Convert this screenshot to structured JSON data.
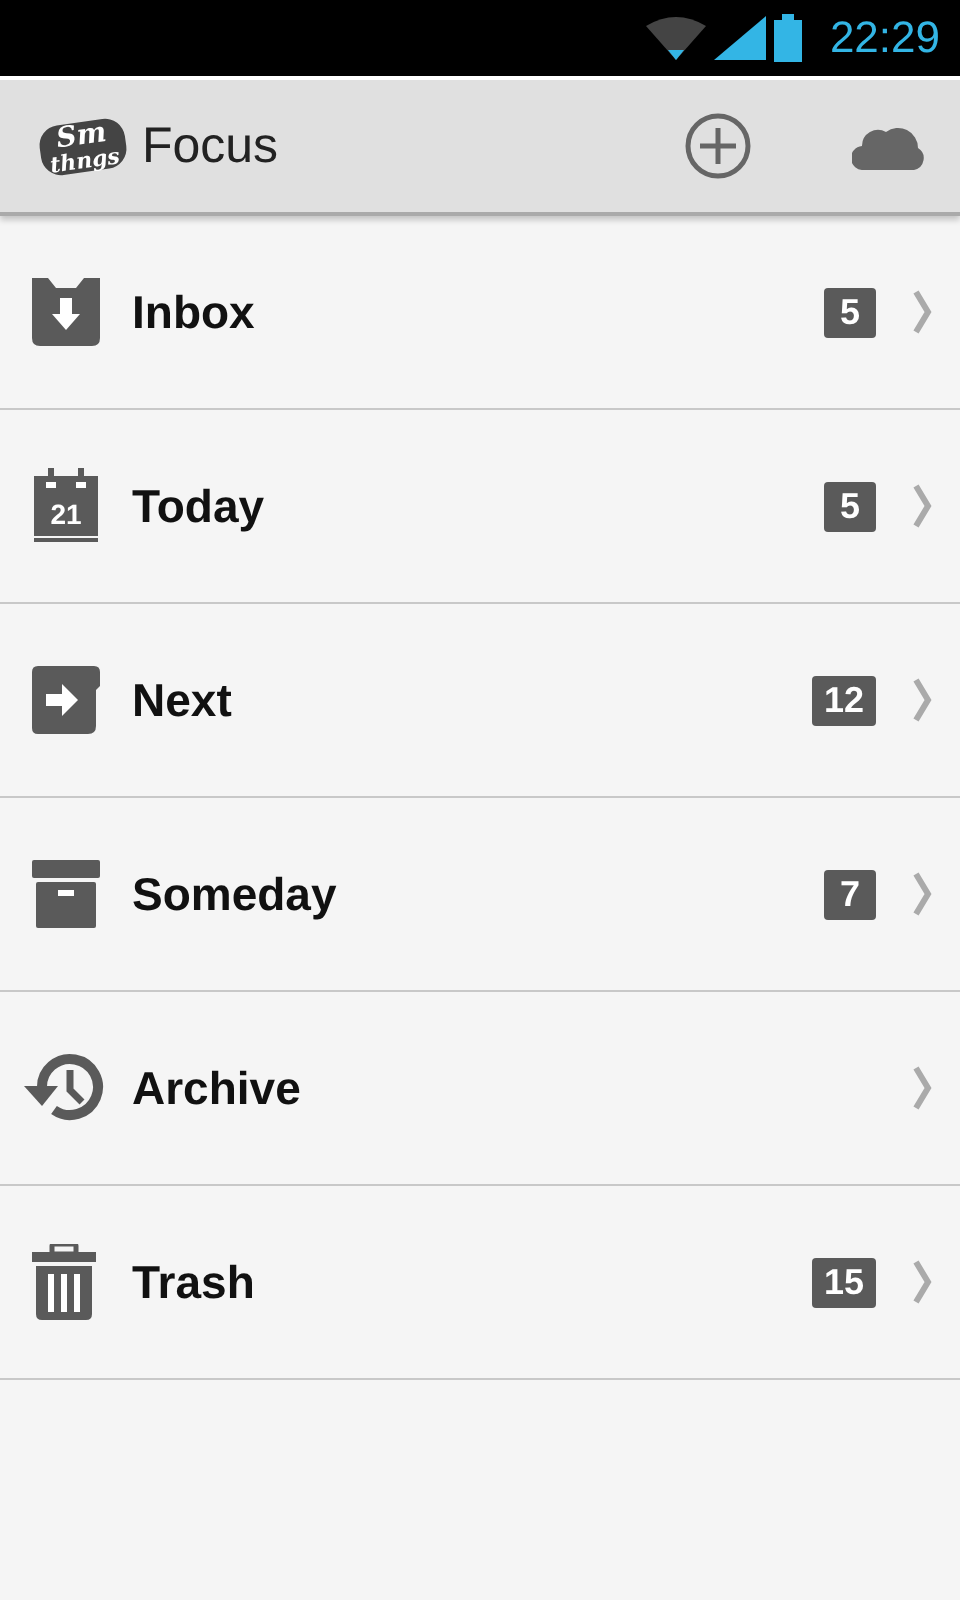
{
  "status_bar": {
    "time": "22:29"
  },
  "header": {
    "logo": [
      "Sm",
      "thngs"
    ],
    "title": "Focus"
  },
  "items": [
    {
      "kind": "inbox",
      "label": "Inbox",
      "count": "5"
    },
    {
      "kind": "today",
      "label": "Today",
      "count": "5",
      "day": "21"
    },
    {
      "kind": "next",
      "label": "Next",
      "count": "12"
    },
    {
      "kind": "someday",
      "label": "Someday",
      "count": "7"
    },
    {
      "kind": "archive",
      "label": "Archive"
    },
    {
      "kind": "trash",
      "label": "Trash",
      "count": "15"
    }
  ]
}
